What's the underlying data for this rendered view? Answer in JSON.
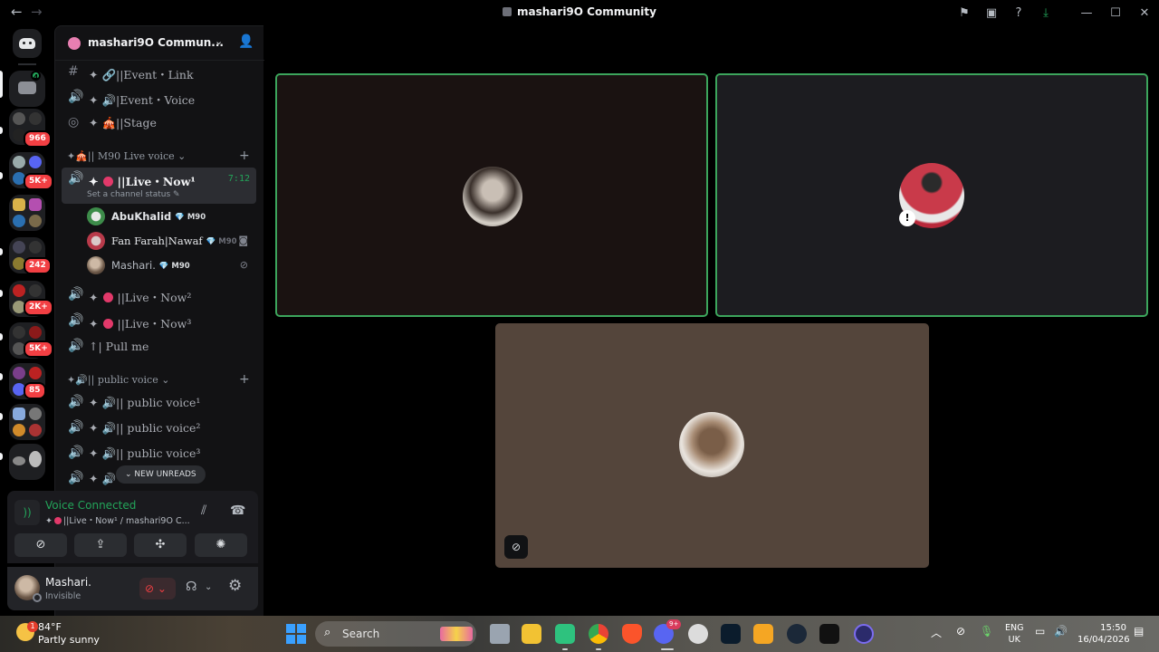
{
  "titlebar": {
    "back": "←",
    "forward": "→",
    "title": "mashari9O Community",
    "icons": [
      "bookmark-icon",
      "inbox-icon",
      "help-icon",
      "download-icon"
    ],
    "minimize": "—",
    "maximize": "☐",
    "close": "✕"
  },
  "rail": {
    "badges": [
      "966",
      "5K+",
      "242",
      "2K+",
      "5K+",
      "85"
    ],
    "home_badge": "4"
  },
  "guild": {
    "name": "mashari9O Commun...",
    "chevron": "⌄"
  },
  "channels": {
    "top": [
      {
        "icon": "#",
        "name": "✦ 🔗||Event・Link"
      },
      {
        "icon": "🔊",
        "name": "✦ 🔊|Event・Voice"
      },
      {
        "icon": "◎",
        "name": "✦ 🎪||Stage"
      }
    ],
    "category_live": "✦🎪|| M90 Live voice ⌄",
    "active": {
      "name": "||Live・Now¹",
      "time": "7:12",
      "status": "Set a channel status ✎"
    },
    "members": [
      {
        "name": "AbuKhalid",
        "tag": "💎 M90"
      },
      {
        "name": "Fan Farah|Nawaf",
        "tag": "💎 M90"
      },
      {
        "name": "Mashari.",
        "tag": "💎 M90"
      }
    ],
    "live_more": [
      {
        "name": "||Live・Now²"
      },
      {
        "name": "||Live・Now³"
      }
    ],
    "pull": "↑| Pull me",
    "category_public": "✦🔊|| public voice ⌄",
    "public": [
      {
        "name": "✦ 🔊|| public voice¹"
      },
      {
        "name": "✦ 🔊|| public voice²"
      },
      {
        "name": "✦ 🔊|| public voice³"
      },
      {
        "name": "✦ 🔊"
      }
    ],
    "new_unreads": "⌄ NEW UNREADS"
  },
  "voice": {
    "title": "Voice Connected",
    "channel": "||Live・Now¹ / mashari9O C..."
  },
  "user": {
    "name": "Mashari.",
    "status": "Invisible"
  },
  "taskbar": {
    "temp": "84°F",
    "weather": "Partly sunny",
    "search": "Search",
    "discord_badge": "9+",
    "lang1": "ENG",
    "lang2": "UK",
    "time": "15:50",
    "date": "16/04/2026"
  }
}
